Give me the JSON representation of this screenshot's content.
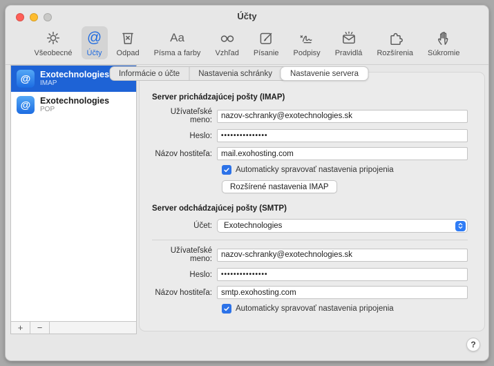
{
  "window": {
    "title": "Účty",
    "help_button": "?"
  },
  "toolbar": {
    "selected": "Účty",
    "items": [
      {
        "label": "Všeobecné"
      },
      {
        "label": "Účty"
      },
      {
        "label": "Odpad"
      },
      {
        "label": "Písma a farby"
      },
      {
        "label": "Vzhľad"
      },
      {
        "label": "Písanie"
      },
      {
        "label": "Podpisy"
      },
      {
        "label": "Pravidlá"
      },
      {
        "label": "Rozšírenia"
      },
      {
        "label": "Súkromie"
      }
    ]
  },
  "sidebar": {
    "accounts": [
      {
        "name": "Exotechnologies",
        "protocol": "IMAP",
        "selected": true
      },
      {
        "name": "Exotechnologies",
        "protocol": "POP",
        "selected": false
      }
    ],
    "add_button": "+",
    "remove_button": "−"
  },
  "tabs": {
    "selected": "Nastavenie servera",
    "items": [
      {
        "label": "Informácie o účte"
      },
      {
        "label": "Nastavenia schránky"
      },
      {
        "label": "Nastavenie servera"
      }
    ]
  },
  "incoming_server": {
    "heading": "Server prichádzajúcej pošty (IMAP)",
    "username_label": "Užívateľské meno:",
    "username_value": "nazov-schranky@exotechnologies.sk",
    "password_label": "Heslo:",
    "password_value": "•••••••••••••••",
    "hostname_label": "Názov hostiteľa:",
    "hostname_value": "mail.exohosting.com",
    "auto_manage_label": "Automaticky spravovať nastavenia pripojenia",
    "auto_manage_checked": true,
    "advanced_button": "Rozšírené nastavenia IMAP"
  },
  "outgoing_server": {
    "heading": "Server odchádzajúcej pošty (SMTP)",
    "account_label": "Účet:",
    "account_value": "Exotechnologies",
    "username_label": "Užívateľské meno:",
    "username_value": "nazov-schranky@exotechnologies.sk",
    "password_label": "Heslo:",
    "password_value": "•••••••••••••••",
    "hostname_label": "Názov hostiteľa:",
    "hostname_value": "smtp.exohosting.com",
    "auto_manage_label": "Automaticky spravovať nastavenia pripojenia",
    "auto_manage_checked": true
  },
  "colors": {
    "selection_blue": "#1e63d6",
    "accent_blue": "#1f6be0",
    "checkbox_blue": "#2c72e8",
    "stepper_blue": "#2f7cf5",
    "window_bg": "#e7e7e7",
    "frame_gray": "#a9a9a9"
  }
}
